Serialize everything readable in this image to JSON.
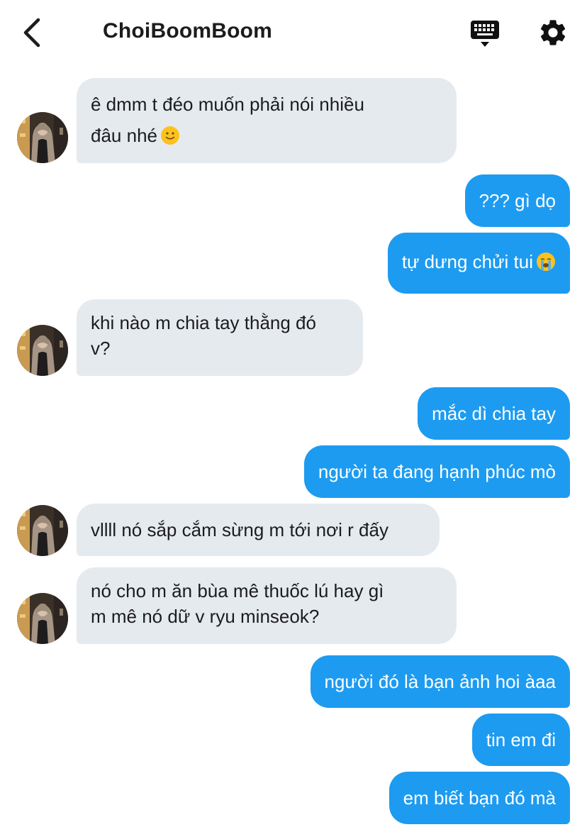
{
  "header": {
    "title": "ChoiBoomBoom",
    "back_icon": "chevron-left-icon",
    "keyboard_icon": "keyboard-icon",
    "settings_icon": "gear-icon"
  },
  "colors": {
    "sent_bubble": "#1d9bf0",
    "received_bubble": "#e5eaef",
    "text_dark": "#1c1c1e"
  },
  "messages": [
    {
      "from": "them",
      "lines": [
        "ê dmm t đéo muốn phải nói nhiều",
        "đâu nhé"
      ],
      "emoji": "slightly-smiling-face"
    },
    {
      "from": "me",
      "lines": [
        "??? gì dọ"
      ]
    },
    {
      "from": "me",
      "lines": [
        "tự dưng chửi tui"
      ],
      "emoji": "loudly-crying-face"
    },
    {
      "from": "them",
      "lines": [
        "khi nào m chia tay thằng đó",
        "v?"
      ]
    },
    {
      "from": "me",
      "lines": [
        "mắc dì chia tay"
      ]
    },
    {
      "from": "me",
      "lines": [
        "người ta đang hạnh phúc mò"
      ]
    },
    {
      "from": "them",
      "lines": [
        "vllll nó sắp cắm sừng m tới nơi r đấy"
      ]
    },
    {
      "from": "them",
      "lines": [
        "nó cho m ăn bùa mê thuốc lú hay gì",
        "m mê nó dữ v ryu minseok?"
      ]
    },
    {
      "from": "me",
      "lines": [
        "người đó là bạn ảnh hoi àaa"
      ]
    },
    {
      "from": "me",
      "lines": [
        "tin em đi"
      ]
    },
    {
      "from": "me",
      "lines": [
        "em biết bạn đó mà"
      ]
    }
  ]
}
